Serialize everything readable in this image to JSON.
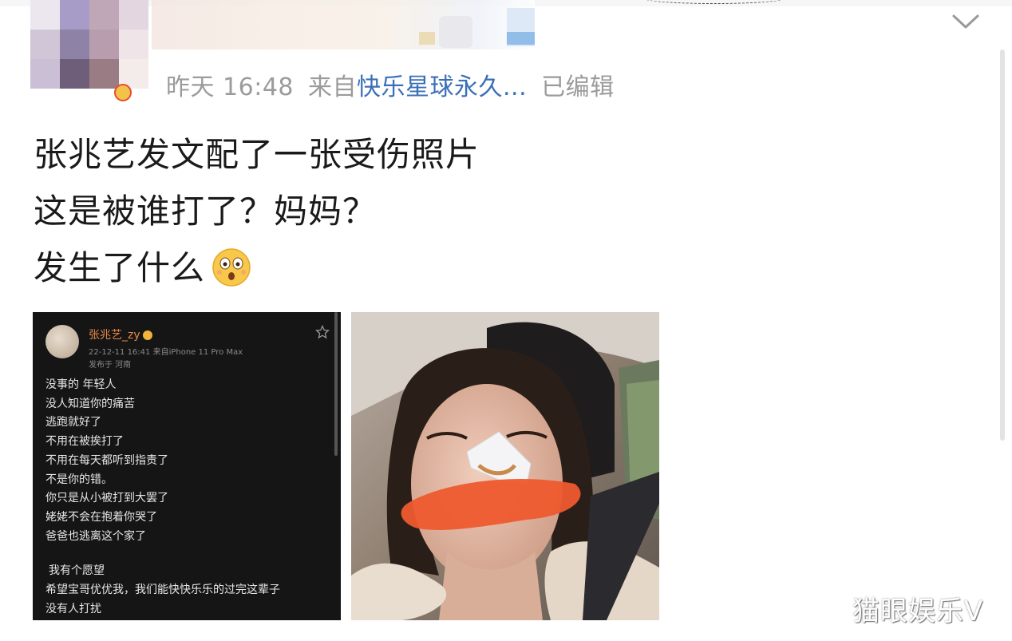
{
  "post": {
    "meta": {
      "time": "昨天 16:48",
      "from_prefix": "来自",
      "source": "快乐星球永久...",
      "edited": "已编辑"
    },
    "text_lines": [
      "张兆艺发文配了一张受伤照片",
      "这是被谁打了？妈妈？",
      "发生了什么"
    ],
    "emoji": "shocked-face-icon"
  },
  "screenshot": {
    "username": "张兆艺_zy",
    "timestamp": "22-12-11 16:41  来自iPhone 11 Pro Max",
    "location": "发布于 河南",
    "lines": [
      "没事的 年轻人",
      "没人知道你的痛苦",
      "逃跑就好了",
      "不用在被挨打了",
      "不用在每天都听到指责了",
      "不是你的错。",
      "你只是从小被打到大罢了",
      "姥姥不会在抱着你哭了",
      "爸爸也逃离这个家了"
    ],
    "lines2": [
      "我有个愿望",
      "希望宝哥优优我，我们能快快乐乐的过完这辈子",
      "没有人打扰"
    ]
  },
  "watermark": "猫眼娱乐V",
  "colors": {
    "meta_gray": "#9b9b9b",
    "source_blue": "#3b6fb6",
    "username_orange": "#e8874a"
  }
}
